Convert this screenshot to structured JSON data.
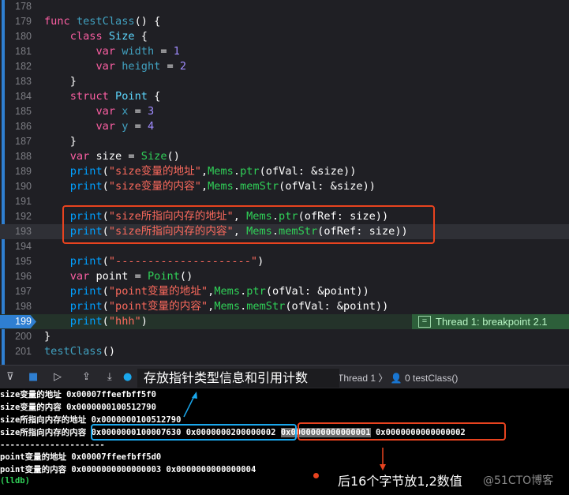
{
  "editor": {
    "lines": [
      {
        "n": "178",
        "html": ""
      },
      {
        "n": "179",
        "html": "<span class='k'>func</span> <span class='f'>testClass</span>() {"
      },
      {
        "n": "180",
        "html": "    <span class='k'>class</span> <span class='t'>Size</span> {"
      },
      {
        "n": "181",
        "html": "        <span class='k'>var</span> <span class='f'>width</span> = <span class='num'>1</span>"
      },
      {
        "n": "182",
        "html": "        <span class='k'>var</span> <span class='f'>height</span> = <span class='num'>2</span>"
      },
      {
        "n": "183",
        "html": "    }"
      },
      {
        "n": "184",
        "html": "    <span class='k'>struct</span> <span class='t'>Point</span> {"
      },
      {
        "n": "185",
        "html": "        <span class='k'>var</span> <span class='f'>x</span> = <span class='num'>3</span>"
      },
      {
        "n": "186",
        "html": "        <span class='k'>var</span> <span class='f'>y</span> = <span class='num'>4</span>"
      },
      {
        "n": "187",
        "html": "    }"
      },
      {
        "n": "188",
        "html": "    <span class='k'>var</span> size = <span class='g'>Size</span>()"
      },
      {
        "n": "189",
        "html": "    <span class='p'>print</span>(<span class='s'>\"size变量的地址\"</span>,<span class='g'>Mems</span>.<span class='g'>ptr</span>(ofVal: &amp;size))"
      },
      {
        "n": "190",
        "html": "    <span class='p'>print</span>(<span class='s'>\"size变量的内容\"</span>,<span class='g'>Mems</span>.<span class='g'>memStr</span>(ofVal: &amp;size))"
      },
      {
        "n": "191",
        "html": ""
      },
      {
        "n": "192",
        "html": "    <span class='p'>print</span>(<span class='s'>\"size所指向内存的地址\"</span>, <span class='g'>Mems</span>.<span class='g'>ptr</span>(ofRef: size))"
      },
      {
        "n": "193",
        "html": "    <span class='p'>print</span>(<span class='s'>\"size所指向内存的内容\"</span>, <span class='g'>Mems</span>.<span class='g'>memStr</span>(ofRef: size))"
      },
      {
        "n": "194",
        "html": ""
      },
      {
        "n": "195",
        "html": "    <span class='p'>print</span>(<span class='s'>\"---------------------\"</span>)"
      },
      {
        "n": "196",
        "html": "    <span class='k'>var</span> point = <span class='g'>Point</span>()"
      },
      {
        "n": "197",
        "html": "    <span class='p'>print</span>(<span class='s'>\"point变量的地址\"</span>,<span class='g'>Mems</span>.<span class='g'>ptr</span>(ofVal: &amp;point))"
      },
      {
        "n": "198",
        "html": "    <span class='p'>print</span>(<span class='s'>\"point变量的内容\"</span>,<span class='g'>Mems</span>.<span class='g'>memStr</span>(ofVal: &amp;point))"
      },
      {
        "n": "199",
        "html": "    <span class='p'>print</span>(<span class='s'>\"hhh\"</span>)"
      },
      {
        "n": "200",
        "html": "}"
      },
      {
        "n": "201",
        "html": "<span class='f'>testClass</span>()"
      }
    ],
    "current_line": "193",
    "breakpoint_line": "199",
    "thread_label": "Thread 1: breakpoint 2.1",
    "thread_icon": "="
  },
  "debugbar": {
    "thread": "Thread 1",
    "frame": "0 testClass()"
  },
  "console": {
    "lines": [
      "size变量的地址 0x00007ffeefbff5f0",
      "size变量的内容 0x0000000100512790",
      "size所指向内存的地址 0x0000000100512790",
      "size所指向内存的内容 ",
      "---------------------",
      "point变量的地址 0x00007ffeefbff5d0",
      "point变量的内容 0x0000000000000003 0x0000000000000004"
    ],
    "content_part1": "0x0000000100007630 0x0000000200000002",
    "content_part2_selected": "0x0000000000000001",
    "content_part3": " 0x0000000000000002",
    "prompt": "(lldb)"
  },
  "annotations": {
    "tooltip": "存放指针类型信息和引用计数",
    "note": "后16个字节放1,2数值",
    "watermark": "@51CTO博客"
  }
}
